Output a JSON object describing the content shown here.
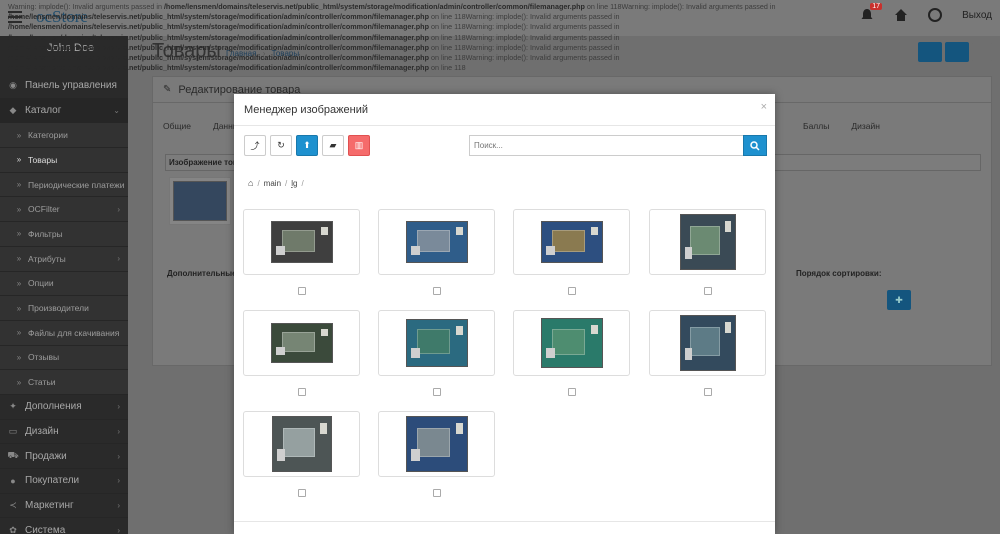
{
  "header": {
    "brand": "ocStore",
    "notifications_count": "17",
    "logout_label": "Выход"
  },
  "warnings": [
    {
      "prefix": "Warning: implode(): Invalid arguments passed in ",
      "path": "/home/lensmen/domains/teleservis.net/public_html/system/storage/modification/admin/controller/common/filemanager.php",
      "suffix": " on line 118"
    },
    {
      "prefix": "Warning: implode(): Invalid arguments passed in ",
      "path": "/home/lensmen/domains/teleservis.net/public_html/system/storage/modification/admin/controller/common/filemanager.php",
      "suffix": " on line 118"
    },
    {
      "prefix": "Warning: implode(): Invalid arguments passed in ",
      "path": "/home/lensmen/domains/teleservis.net/public_html/system/storage/modification/admin/controller/common/filemanager.php",
      "suffix": " on line 118"
    },
    {
      "prefix": "Warning: implode(): Invalid arguments passed in ",
      "path": "/home/lensmen/domains/teleservis.net/public_html/system/storage/modification/admin/controller/common/filemanager.php",
      "suffix": " on line 118"
    },
    {
      "prefix": "Warning: implode(): Invalid arguments passed in ",
      "path": "/home/lensmen/domains/teleservis.net/public_html/system/storage/modification/admin/controller/common/filemanager.php",
      "suffix": " on line 118"
    },
    {
      "prefix": "Warning: implode(): Invalid arguments passed in ",
      "path": "/home/lensmen/domains/teleservis.net/public_html/system/storage/modification/admin/controller/common/filemanager.php",
      "suffix": " on line 118"
    },
    {
      "prefix": "Warning: implode(): Invalid arguments passed in ",
      "path": "/home/lensmen/domains/teleservis.net/public_html/system/storage/modification/admin/controller/common/filemanager.php",
      "suffix": " on line 118"
    }
  ],
  "sidebar": {
    "user_name": "John Doe",
    "items": [
      {
        "label": "Панель управления",
        "icon": "dashboard-icon",
        "glyph": "◉",
        "type": "section",
        "arrow": ""
      },
      {
        "label": "Каталог",
        "icon": "tag-icon",
        "glyph": "◆",
        "type": "section open",
        "arrow": "⌄"
      },
      {
        "label": "Категории",
        "icon": "chevron-right-icon",
        "glyph": "»",
        "type": "sub",
        "arrow": ""
      },
      {
        "label": "Товары",
        "icon": "chevron-right-icon",
        "glyph": "»",
        "type": "sub active",
        "arrow": ""
      },
      {
        "label": "Периодические платежи",
        "icon": "chevron-right-icon",
        "glyph": "»",
        "type": "sub",
        "arrow": ""
      },
      {
        "label": "OCFilter",
        "icon": "chevron-right-icon",
        "glyph": "»",
        "type": "sub",
        "arrow": "›"
      },
      {
        "label": "Фильтры",
        "icon": "chevron-right-icon",
        "glyph": "»",
        "type": "sub",
        "arrow": ""
      },
      {
        "label": "Атрибуты",
        "icon": "chevron-right-icon",
        "glyph": "»",
        "type": "sub",
        "arrow": "›"
      },
      {
        "label": "Опции",
        "icon": "chevron-right-icon",
        "glyph": "»",
        "type": "sub",
        "arrow": ""
      },
      {
        "label": "Производители",
        "icon": "chevron-right-icon",
        "glyph": "»",
        "type": "sub",
        "arrow": ""
      },
      {
        "label": "Файлы для скачивания",
        "icon": "chevron-right-icon",
        "glyph": "»",
        "type": "sub",
        "arrow": ""
      },
      {
        "label": "Отзывы",
        "icon": "chevron-right-icon",
        "glyph": "»",
        "type": "sub",
        "arrow": ""
      },
      {
        "label": "Статьи",
        "icon": "chevron-right-icon",
        "glyph": "»",
        "type": "sub",
        "arrow": ""
      },
      {
        "label": "Дополнения",
        "icon": "puzzle-icon",
        "glyph": "✦",
        "type": "section",
        "arrow": "›"
      },
      {
        "label": "Дизайн",
        "icon": "monitor-icon",
        "glyph": "▭",
        "type": "section",
        "arrow": "›"
      },
      {
        "label": "Продажи",
        "icon": "cart-icon",
        "glyph": "⛟",
        "type": "section",
        "arrow": "›"
      },
      {
        "label": "Покупатели",
        "icon": "user-icon",
        "glyph": "●",
        "type": "section",
        "arrow": "›"
      },
      {
        "label": "Маркетинг",
        "icon": "share-icon",
        "glyph": "≺",
        "type": "section",
        "arrow": "›"
      },
      {
        "label": "Система",
        "icon": "gear-icon",
        "glyph": "✿",
        "type": "section",
        "arrow": "›"
      }
    ]
  },
  "page": {
    "title": "Товары",
    "breadcrumb": [
      "Главная",
      "Товары"
    ],
    "panel_title": "Редактирование товара",
    "tabs_left": [
      "Общие",
      "Данные"
    ],
    "tabs_right": [
      "Баллы",
      "Дизайн"
    ],
    "image_table_header": "Изображение товара",
    "additional_label": "Дополнительные",
    "sort_label": "Порядок сортировки:"
  },
  "modal": {
    "title": "Менеджер изображений",
    "close": "×",
    "search_placeholder": "Поиск...",
    "path": [
      "main",
      "lg"
    ],
    "toolbar": [
      {
        "name": "parent-folder-button",
        "icon": "level-up-icon",
        "glyph": "⤴",
        "style": "default"
      },
      {
        "name": "refresh-button",
        "icon": "refresh-icon",
        "glyph": "↻",
        "style": "default"
      },
      {
        "name": "upload-button",
        "icon": "upload-icon",
        "glyph": "⬆",
        "style": "primary"
      },
      {
        "name": "new-folder-button",
        "icon": "folder-icon",
        "glyph": "▰",
        "style": "default"
      },
      {
        "name": "delete-button",
        "icon": "trash-icon",
        "glyph": "▥",
        "style": "danger"
      }
    ],
    "images": [
      {
        "board": "#3f3f3f",
        "inner": "#6f7a6a",
        "w": 62,
        "h": 42
      },
      {
        "board": "#2f5d8a",
        "inner": "#7a8a9a",
        "w": 62,
        "h": 42
      },
      {
        "board": "#2d4f80",
        "inner": "#8a7a50",
        "w": 62,
        "h": 42
      },
      {
        "board": "#3a4a55",
        "inner": "#6b8a72",
        "w": 56,
        "h": 56
      },
      {
        "board": "#3b4a3b",
        "inner": "#768574",
        "w": 62,
        "h": 40
      },
      {
        "board": "#2b6a80",
        "inner": "#3f7a6a",
        "w": 62,
        "h": 48
      },
      {
        "board": "#2a7a6a",
        "inner": "#4e8d70",
        "w": 62,
        "h": 50
      },
      {
        "board": "#334a5d",
        "inner": "#5d7b86",
        "w": 56,
        "h": 56
      },
      {
        "board": "#4d5555",
        "inner": "#95a0a0",
        "w": 60,
        "h": 56
      },
      {
        "board": "#2c4c7a",
        "inner": "#7a8890",
        "w": 62,
        "h": 56
      }
    ]
  },
  "colors": {
    "primary": "#1e91cf",
    "danger": "#f56b6b",
    "sidebar_bg": "#2a2a2a"
  }
}
